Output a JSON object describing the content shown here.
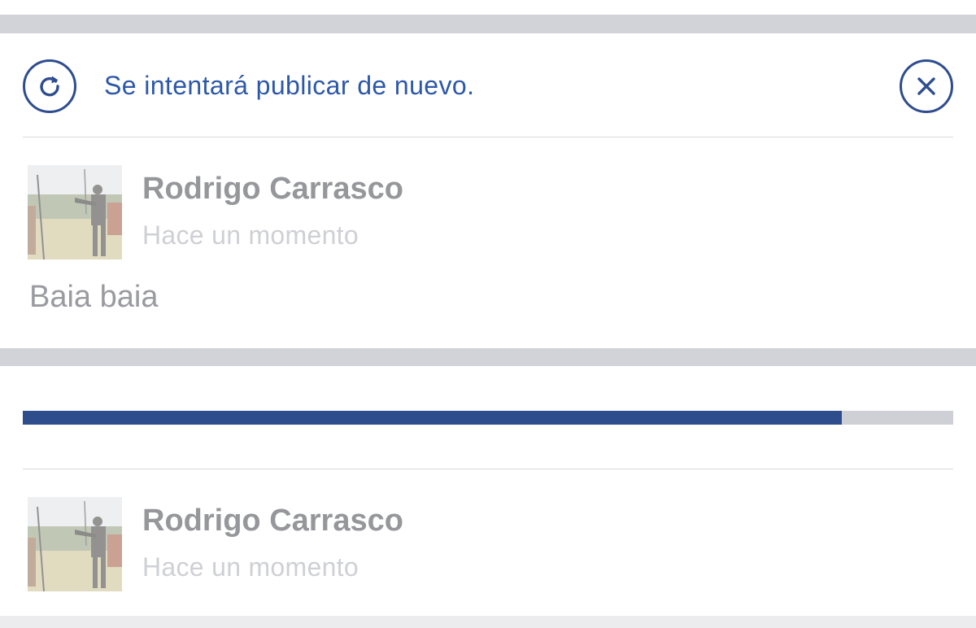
{
  "retry_banner": {
    "icon": "refresh-icon",
    "message": "Se intentará publicar de nuevo.",
    "dismiss_icon": "close-icon",
    "accent_color": "#2e4d8f"
  },
  "failed_post": {
    "author": "Rodrigo Carrasco",
    "time": "Hace un momento",
    "text": "Baia baia"
  },
  "upload": {
    "progress_fraction": 0.88,
    "progress_color": "#2d4d8d",
    "track_color": "#cfd0d6"
  },
  "pending_post": {
    "author": "Rodrigo Carrasco",
    "time": "Hace un momento"
  }
}
